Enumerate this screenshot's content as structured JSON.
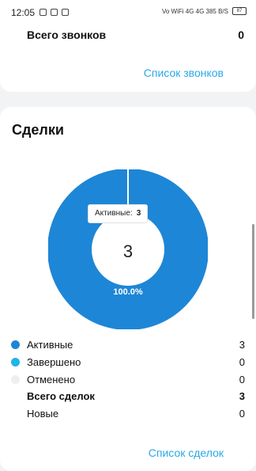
{
  "status_bar": {
    "time": "12:05",
    "right_text": "Vo WiFi 4G 4G 385 B/S",
    "battery": "87"
  },
  "calls_card": {
    "total_label": "Всего звонков",
    "total_value": "0",
    "link_label": "Список звонков"
  },
  "deals_card": {
    "title": "Сделки",
    "center_value": "3",
    "percent_label": "100.0%",
    "tooltip": {
      "label": "Активные:",
      "value": "3"
    },
    "legend": [
      {
        "label": "Активные",
        "value": "3",
        "color": "#1e86d6"
      },
      {
        "label": "Завершено",
        "value": "0",
        "color": "#1fb4ea"
      },
      {
        "label": "Отменено",
        "value": "0",
        "color": "#eceef1"
      }
    ],
    "total_label": "Всего сделок",
    "total_value": "3",
    "new_label": "Новые",
    "new_value": "0",
    "link_label": "Список сделок"
  },
  "colors": {
    "accent": "#29a8e8",
    "donut": "#1e86d6"
  }
}
